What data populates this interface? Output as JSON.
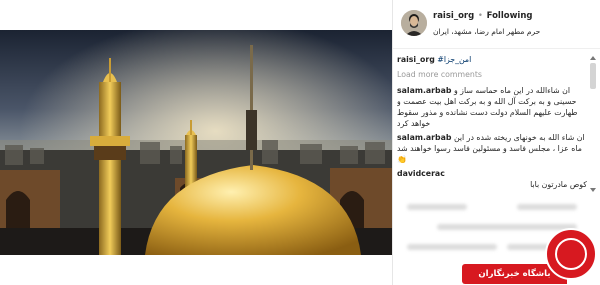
{
  "post": {
    "username": "raisi_org",
    "separator": "•",
    "follow_label": "Following",
    "location": "حرم مطهر امام رضا، مشهد، ایران"
  },
  "caption": {
    "username": "raisi_org",
    "hashtag": "#امن_جزا"
  },
  "load_more": "Load more comments",
  "comments": [
    {
      "author": "salam.arbab",
      "text": "ان شاءالله در این ماه حماسه ساز و حسینی و به برکت آل الله و به برکت اهل بیت عصمت و طهارت علیهم السلام دولت دست نشانده و مذور سقوط خواهد کرد"
    },
    {
      "author": "salam.arbab",
      "text": "ان شاء الله به خونهای ریخته شده در این ماه عزا ، مجلس فاسد و مسئولین فاسد رسوا خواهند شد",
      "emoji": "👏"
    },
    {
      "author": "davidcerac",
      "text": "کوص مادرتون بابا"
    }
  ],
  "watermark": {
    "label": "باشگاه خبرنگاران"
  },
  "colors": {
    "brand_red": "#d71920",
    "link_blue": "#003569",
    "dome_gold": "#d9a531"
  }
}
